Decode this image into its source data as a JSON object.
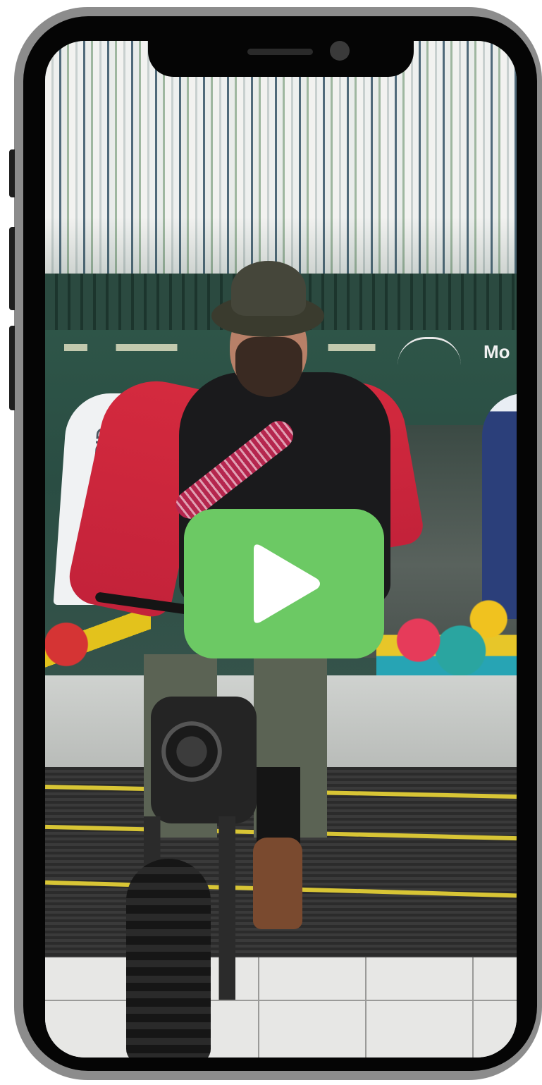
{
  "colors": {
    "frame_outer": "#8c8c8c",
    "frame_body": "#050505",
    "play_button_bg": "#6cc964",
    "play_icon": "#ffffff"
  },
  "video": {
    "poster_text": {
      "building_sign": "Mo",
      "left_banner": "LLESPID"
    },
    "overlay_icon": "play-icon"
  }
}
